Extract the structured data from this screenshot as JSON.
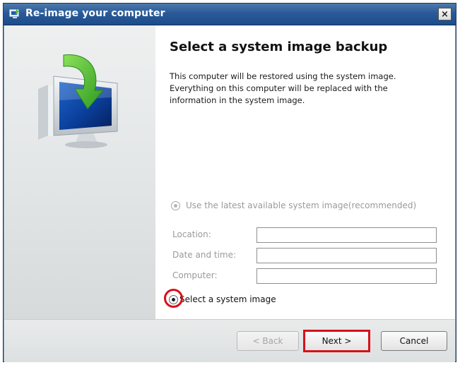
{
  "window": {
    "title": "Re-image your computer",
    "close_label": "×"
  },
  "content": {
    "heading": "Select a system image backup",
    "description_line1": "This computer will be restored using the system image.",
    "description_line2": "Everything on this computer will be replaced with the",
    "description_line3": "information in the system image.",
    "option_latest": "Use the latest available system image(recommended)",
    "label_location": "Location:",
    "label_date_time": "Date and time:",
    "label_computer": "Computer:",
    "value_location": "",
    "value_date_time": "",
    "value_computer": "",
    "option_select": "Select a system image",
    "selected_option": "select"
  },
  "buttons": {
    "back": "< Back",
    "next": "Next >",
    "cancel": "Cancel"
  },
  "colors": {
    "titlebar": "#2a5a98",
    "highlight": "#d8101a"
  },
  "icons": {
    "title": "reimage-app-icon",
    "hero": "computer-restore-icon"
  }
}
